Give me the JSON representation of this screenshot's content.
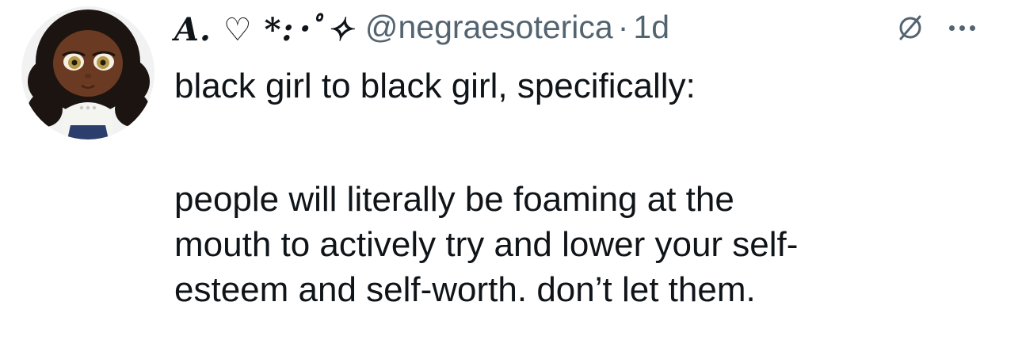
{
  "tweet": {
    "display_name": "𝑨. ♡ *:･ﾟ✧",
    "handle": "@negraesoterica",
    "separator": "·",
    "time": "1d",
    "body_first": "black girl to black girl, specifically:",
    "body_lines": [
      "people will literally be foaming at the",
      "mouth to actively try and lower your self-",
      "esteem and self-worth. don’t let them."
    ]
  },
  "icons": {
    "grok": "grok-slash-icon",
    "more": "more-horizontal-icon"
  },
  "colors": {
    "text": "#0f1419",
    "secondary": "#536471"
  }
}
